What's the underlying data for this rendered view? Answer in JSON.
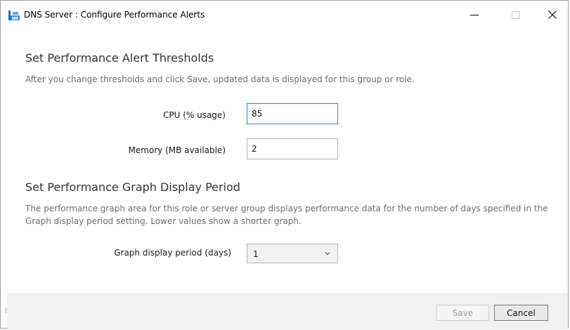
{
  "window": {
    "title": "DNS Server : Configure Performance Alerts",
    "controls": {
      "minimize": "minimize",
      "maximize": "maximize",
      "close": "close"
    }
  },
  "thresholds": {
    "title": "Set Performance Alert Thresholds",
    "description": "After you change thresholds and click Save, updated data is displayed for this group or role.",
    "cpu": {
      "label": "CPU (% usage)",
      "value": "85"
    },
    "memory": {
      "label": "Memory (MB available)",
      "value": "2"
    }
  },
  "graph_period": {
    "title": "Set Performance Graph Display Period",
    "description": "The performance graph area for this role or server group displays performance data for the number of days specified in the Graph display period setting. Lower values show a shorter graph.",
    "label": "Graph display period (days)",
    "selected": "1"
  },
  "footer": {
    "save_label": "Save",
    "save_enabled": false,
    "cancel_label": "Cancel"
  },
  "icons": {
    "app": "server-manager-icon",
    "chevron": "chevron-down-icon"
  },
  "colors": {
    "focus_border": "#3a7bd5",
    "footer_bg": "#f0f0f0",
    "description_text": "#6e6e6e"
  }
}
